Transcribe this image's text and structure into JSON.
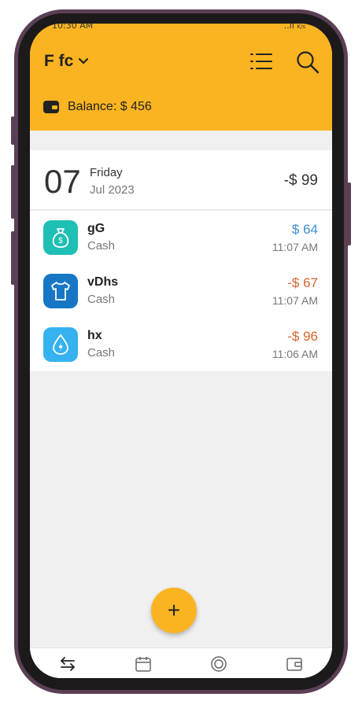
{
  "status_bar": {
    "time": "10:30 AM",
    "right": "..ıl",
    "speed": "K/s"
  },
  "header": {
    "wallet_name": "F fc",
    "balance_label": "Balance: $ 456"
  },
  "day": {
    "date_num": "07",
    "weekday": "Friday",
    "month_year": "Jul 2023",
    "total": "-$ 99"
  },
  "transactions": [
    {
      "name": "gG",
      "account": "Cash",
      "amount": "$ 64",
      "time": "11:07 AM",
      "amount_color": "#3d8fd6",
      "icon": "money-bag-icon",
      "icon_bg": "#1ebfb4"
    },
    {
      "name": "vDhs",
      "account": "Cash",
      "amount": "-$ 67",
      "time": "11:07 AM",
      "amount_color": "#d8642c",
      "icon": "tshirt-icon",
      "icon_bg": "#1777c5"
    },
    {
      "name": "hx",
      "account": "Cash",
      "amount": "-$ 96",
      "time": "11:06 AM",
      "amount_color": "#d8642c",
      "icon": "water-drop-icon",
      "icon_bg": "#35b2ef"
    }
  ],
  "fab": {
    "label": "+"
  },
  "colors": {
    "accent": "#fbb421",
    "income": "#3d8fd6",
    "expense": "#d8642c"
  },
  "nav_icons": [
    "transactions-icon",
    "calendar-icon",
    "budget-icon",
    "wallet-icon"
  ]
}
